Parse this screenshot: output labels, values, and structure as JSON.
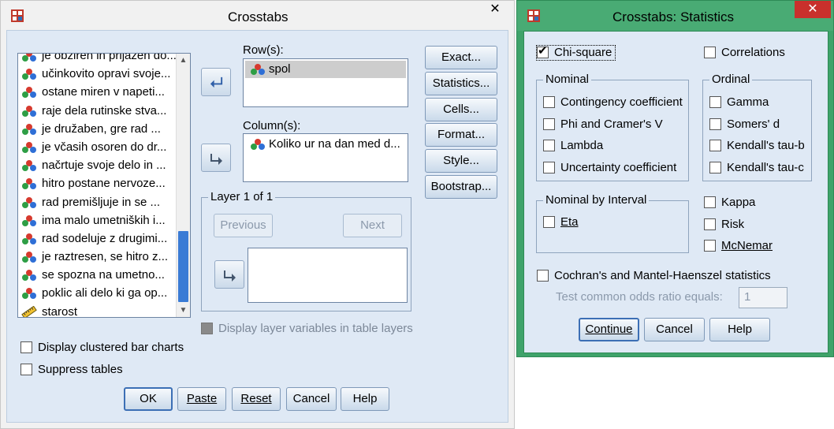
{
  "crosstabs": {
    "title": "Crosstabs",
    "close_glyph": "✕",
    "variables": [
      {
        "label": "je obziren in prijazen do...",
        "icon": "nominal-variable-icon"
      },
      {
        "label": "učinkovito opravi svoje...",
        "icon": "nominal-variable-icon"
      },
      {
        "label": "ostane miren v napeti...",
        "icon": "nominal-variable-icon"
      },
      {
        "label": "raje dela rutinske stva...",
        "icon": "nominal-variable-icon"
      },
      {
        "label": "je družaben, gre rad ...",
        "icon": "nominal-variable-icon"
      },
      {
        "label": "je včasih osoren do dr...",
        "icon": "nominal-variable-icon"
      },
      {
        "label": "načrtuje svoje delo in ...",
        "icon": "nominal-variable-icon"
      },
      {
        "label": "hitro postane nervoze...",
        "icon": "nominal-variable-icon"
      },
      {
        "label": "rad premišljuje in se ...",
        "icon": "nominal-variable-icon"
      },
      {
        "label": "ima malo umetniških i...",
        "icon": "nominal-variable-icon"
      },
      {
        "label": "rad sodeluje z drugimi...",
        "icon": "nominal-variable-icon"
      },
      {
        "label": "je raztresen, se hitro z...",
        "icon": "nominal-variable-icon"
      },
      {
        "label": "se spozna na umetno...",
        "icon": "nominal-variable-icon"
      },
      {
        "label": "poklic ali delo ki ga op...",
        "icon": "nominal-variable-icon"
      },
      {
        "label": "starost",
        "icon": "scale-ruler-icon"
      }
    ],
    "rows_label": "Row(s):",
    "rows_value": "spol",
    "columns_label": "Column(s):",
    "columns_value": "Koliko ur na dan med d...",
    "layer_title": "Layer 1 of 1",
    "previous_label": "Previous",
    "next_label": "Next",
    "display_layer_label": "Display layer variables in table layers",
    "display_clustered_label": "Display clustered bar charts",
    "suppress_tables_label": "Suppress tables",
    "side_buttons": [
      "Exact...",
      "Statistics...",
      "Cells...",
      "Format...",
      "Style...",
      "Bootstrap..."
    ],
    "bottom_buttons": [
      "OK",
      "Paste",
      "Reset",
      "Cancel",
      "Help"
    ]
  },
  "statistics": {
    "title": "Crosstabs: Statistics",
    "close_glyph": "✕",
    "chi_square": "Chi-square",
    "correlations": "Correlations",
    "nominal_title": "Nominal",
    "nominal_items": [
      "Contingency coefficient",
      "Phi and Cramer's V",
      "Lambda",
      "Uncertainty coefficient"
    ],
    "ordinal_title": "Ordinal",
    "ordinal_items": [
      "Gamma",
      "Somers' d",
      "Kendall's tau-b",
      "Kendall's tau-c"
    ],
    "nbi_title": "Nominal by Interval",
    "eta": "Eta",
    "kappa": "Kappa",
    "risk": "Risk",
    "mcnemar": "McNemar",
    "cochran": "Cochran's and Mantel-Haenszel statistics",
    "test_common": "Test common odds ratio equals:",
    "test_value": "1",
    "continue": "Continue",
    "cancel": "Cancel",
    "help": "Help"
  },
  "colors": {
    "stats_frame": "#3fa36a",
    "dialog_bg": "#dfe9f5",
    "close_red": "#c9302c",
    "scroll_thumb": "#3a7bd5"
  }
}
